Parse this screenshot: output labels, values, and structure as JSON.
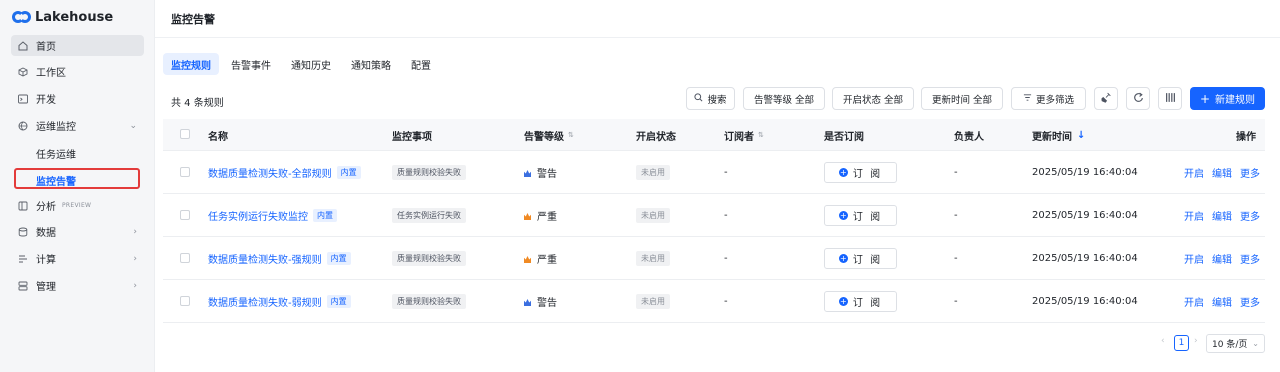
{
  "app": {
    "name": "Lakehouse"
  },
  "sidebar": {
    "items": [
      {
        "label": "首页",
        "icon": "home-icon"
      },
      {
        "label": "工作区",
        "icon": "cube-icon"
      },
      {
        "label": "开发",
        "icon": "terminal-icon"
      },
      {
        "label": "运维监控",
        "icon": "monitor-icon"
      },
      {
        "label": "分析",
        "icon": "book-icon",
        "badge": "PREVIEW"
      },
      {
        "label": "数据",
        "icon": "database-icon"
      },
      {
        "label": "计算",
        "icon": "compute-icon"
      },
      {
        "label": "管理",
        "icon": "manage-icon"
      }
    ],
    "sub_items": [
      {
        "label": "任务运维"
      },
      {
        "label": "监控告警"
      }
    ]
  },
  "header": {
    "title": "监控告警"
  },
  "tabs": [
    {
      "label": "监控规则"
    },
    {
      "label": "告警事件"
    },
    {
      "label": "通知历史"
    },
    {
      "label": "通知策略"
    },
    {
      "label": "配置"
    }
  ],
  "toolbar": {
    "count_text": "共 4 条规则",
    "search_label": "搜索",
    "filter_level": "告警等级 全部",
    "filter_status": "开启状态 全部",
    "filter_updated": "更新时间 全部",
    "more_filters": "更多筛选",
    "new_rule": "新建规则"
  },
  "table": {
    "columns": [
      "名称",
      "监控事项",
      "告警等级",
      "开启状态",
      "订阅者",
      "是否订阅",
      "负责人",
      "更新时间",
      "操作"
    ],
    "rows": [
      {
        "name": "数据质量检测失败-全部规则",
        "builtin": "内置",
        "item": "质量规则校验失败",
        "level": "警告",
        "level_color": "#3b6fe0",
        "status": "未启用",
        "subscribers": "-",
        "subscribe": "订 阅",
        "owner": "-",
        "updated": "2025/05/19 16:40:04",
        "actions": [
          "开启",
          "编辑",
          "更多"
        ]
      },
      {
        "name": "任务实例运行失败监控",
        "builtin": "内置",
        "item": "任务实例运行失败",
        "level": "严重",
        "level_color": "#f08a24",
        "status": "未启用",
        "subscribers": "-",
        "subscribe": "订 阅",
        "owner": "-",
        "updated": "2025/05/19 16:40:04",
        "actions": [
          "开启",
          "编辑",
          "更多"
        ]
      },
      {
        "name": "数据质量检测失败-强规则",
        "builtin": "内置",
        "item": "质量规则校验失败",
        "level": "严重",
        "level_color": "#f08a24",
        "status": "未启用",
        "subscribers": "-",
        "subscribe": "订 阅",
        "owner": "-",
        "updated": "2025/05/19 16:40:04",
        "actions": [
          "开启",
          "编辑",
          "更多"
        ]
      },
      {
        "name": "数据质量检测失败-弱规则",
        "builtin": "内置",
        "item": "质量规则校验失败",
        "level": "警告",
        "level_color": "#3b6fe0",
        "status": "未启用",
        "subscribers": "-",
        "subscribe": "订 阅",
        "owner": "-",
        "updated": "2025/05/19 16:40:04",
        "actions": [
          "开启",
          "编辑",
          "更多"
        ]
      }
    ]
  },
  "pagination": {
    "current_page": "1",
    "page_size": "10 条/页"
  },
  "colors": {
    "accent": "#1664ff",
    "highlight_border": "#e33b3b"
  }
}
